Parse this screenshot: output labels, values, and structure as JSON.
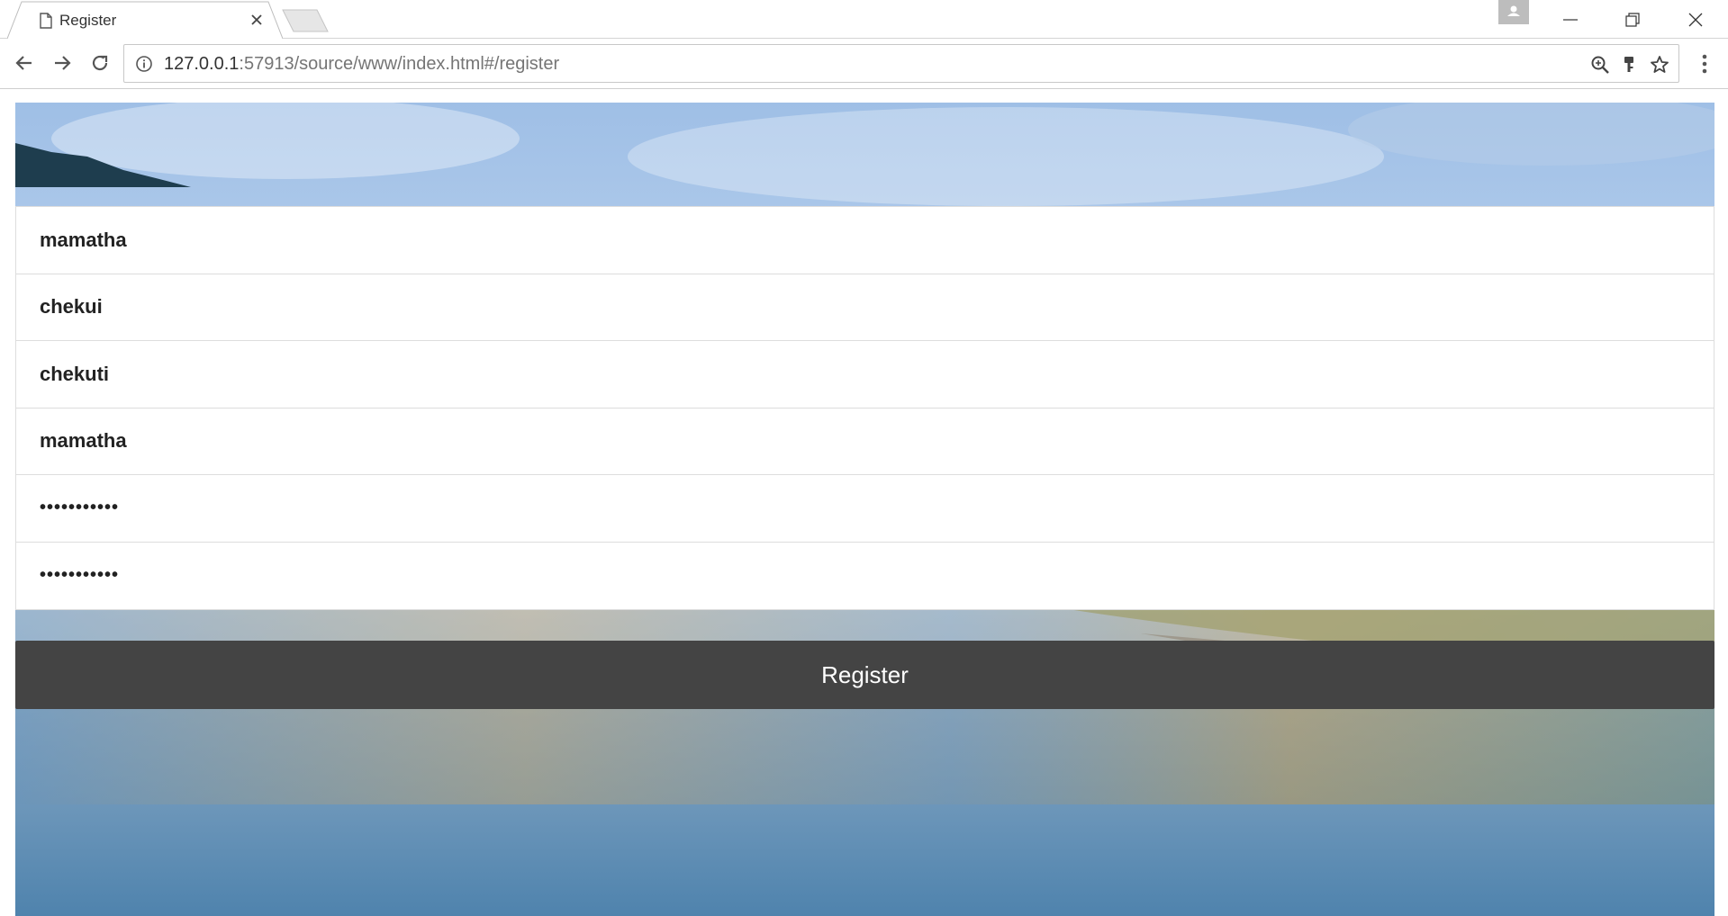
{
  "browser": {
    "tab_title": "Register",
    "url_host": "127.0.0.1",
    "url_rest": ":57913/source/www/index.html#/register"
  },
  "form": {
    "fields": [
      {
        "value": "mamatha",
        "type": "text"
      },
      {
        "value": "chekui",
        "type": "text"
      },
      {
        "value": "chekuti",
        "type": "text"
      },
      {
        "value": "mamatha",
        "type": "text"
      },
      {
        "value": "•••••••••••",
        "type": "password"
      },
      {
        "value": "•••••••••••",
        "type": "password"
      }
    ],
    "submit_label": "Register"
  },
  "colors": {
    "button_bg": "#444444",
    "button_text": "#ffffff"
  }
}
